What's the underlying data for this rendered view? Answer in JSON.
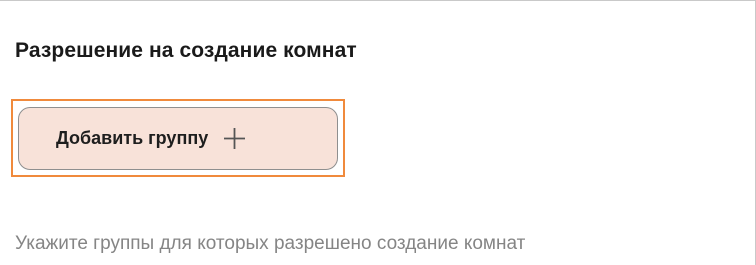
{
  "section": {
    "title": "Разрешение на создание комнат",
    "add_button_label": "Добавить группу",
    "add_button_icon": "plus-icon",
    "hint": "Укажите группы для которых разрешено создание комнат"
  },
  "colors": {
    "highlight_border": "#f08a3c",
    "button_background": "#f8e2d9",
    "hint_text": "#858585"
  }
}
